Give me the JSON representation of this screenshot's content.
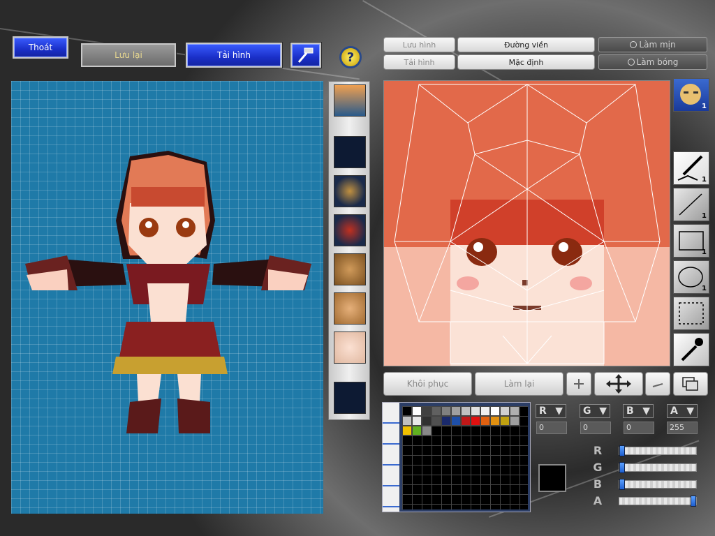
{
  "top_buttons": {
    "exit": "Thoát",
    "save": "Lưu lại",
    "load": "Tải hình"
  },
  "tabs": {
    "save_image": "Lưu hình",
    "outline": "Đường viền",
    "load_image": "Tải hình",
    "default": "Mặc định",
    "smooth": "Làm mịn",
    "shine": "Làm bóng"
  },
  "bottom_buttons": {
    "restore": "Khôi phục",
    "redo": "Làm lại"
  },
  "tools": {
    "pen_count": "1",
    "line_count": "1",
    "rect_count": "1",
    "ellipse_count": "1",
    "face_badge": "1"
  },
  "channels": {
    "r_label": "R",
    "g_label": "G",
    "b_label": "B",
    "a_label": "A",
    "r": "0",
    "g": "0",
    "b": "0",
    "a": "255"
  },
  "colors": {
    "palette_row1": [
      "#000000",
      "#ffffff",
      "#404040",
      "#606060",
      "#808080",
      "#a0a0a0",
      "#c0c0c0",
      "#e0e0e0",
      "#f0f0f0",
      "#ffffff",
      "#d0d0d0",
      "#b0b0b0"
    ],
    "palette_row2": [
      "#c0c0c0",
      "#e8e8e8",
      "#303030",
      "#505050",
      "#1a2a6c",
      "#1e4fa8",
      "#c01818",
      "#e01010",
      "#e06010",
      "#e09010",
      "#c0a010",
      "#a0a0a0"
    ],
    "palette_row3": [
      "#f0c000",
      "#60b020",
      "#888888"
    ]
  },
  "sliders": {
    "r": 0,
    "g": 0,
    "b": 0,
    "a": 1
  }
}
